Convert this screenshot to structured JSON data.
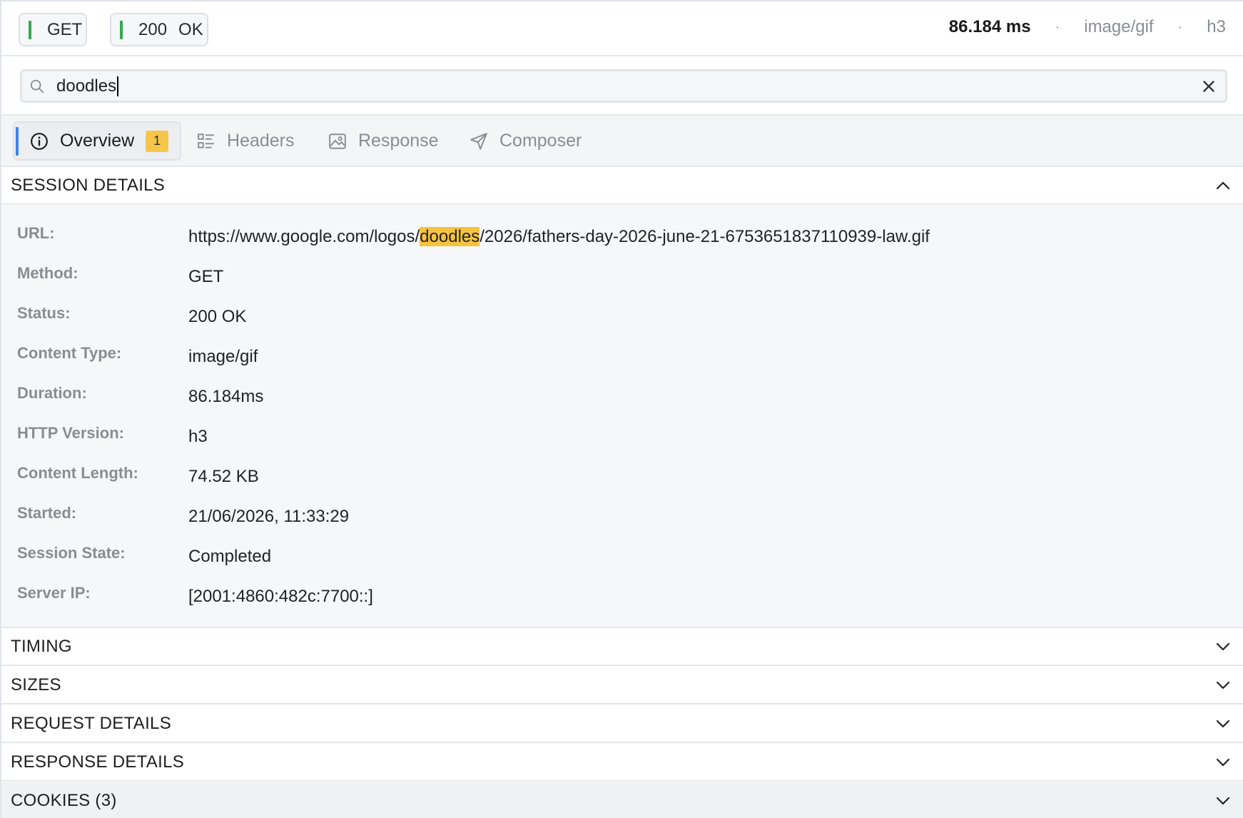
{
  "topbar": {
    "method": "GET",
    "status_code": "200",
    "status_text": "OK",
    "duration": "86.184 ms",
    "content_type": "image/gif",
    "protocol": "h3",
    "separator": "·"
  },
  "search": {
    "value": "doodles",
    "icon": "search-icon",
    "clear_icon": "close-icon"
  },
  "tabs": [
    {
      "label": "Overview",
      "icon": "info-icon",
      "badge": "1",
      "active": true
    },
    {
      "label": "Headers",
      "icon": "list-icon",
      "active": false
    },
    {
      "label": "Response",
      "icon": "image-icon",
      "active": false
    },
    {
      "label": "Composer",
      "icon": "send-icon",
      "active": false
    }
  ],
  "session": {
    "title": "SESSION DETAILS",
    "rows": [
      {
        "label": "URL:",
        "value_pre": "https://www.google.com/logos/",
        "value_hl": "doodles",
        "value_post": "/2026/fathers-day-2026-june-21-6753651837110939-law.gif"
      },
      {
        "label": "Method:",
        "value": "GET"
      },
      {
        "label": "Status:",
        "value": "200 OK"
      },
      {
        "label": "Content Type:",
        "value": "image/gif"
      },
      {
        "label": "Duration:",
        "value": "86.184ms"
      },
      {
        "label": "HTTP Version:",
        "value": "h3"
      },
      {
        "label": "Content Length:",
        "value": "74.52 KB"
      },
      {
        "label": "Started:",
        "value": "21/06/2026, 11:33:29"
      },
      {
        "label": "Session State:",
        "value": "Completed"
      },
      {
        "label": "Server IP:",
        "value": "[2001:4860:482c:7700::]"
      }
    ]
  },
  "sections": {
    "timing": "TIMING",
    "sizes": "SIZES",
    "request": "REQUEST DETAILS",
    "response": "RESPONSE DETAILS",
    "cookies": "COOKIES (3)"
  },
  "colors": {
    "accent_blue": "#3f83e6",
    "status_green": "#36a852",
    "highlight_yellow": "#f6c33d"
  }
}
